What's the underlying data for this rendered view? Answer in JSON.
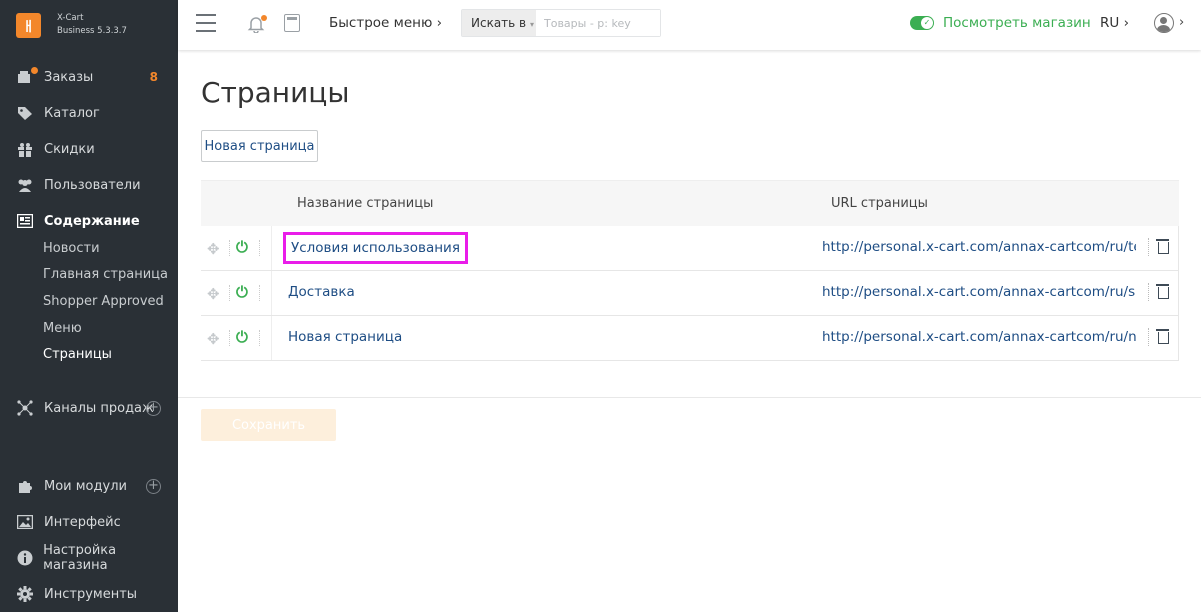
{
  "brand": {
    "name": "X-Cart",
    "edition": "Business 5.3.3.7",
    "logo_glyph": "ㅐ"
  },
  "sidebar": {
    "items": [
      {
        "label": "Заказы",
        "icon": "orders-icon",
        "badge": "8"
      },
      {
        "label": "Каталог",
        "icon": "tag-icon"
      },
      {
        "label": "Скидки",
        "icon": "gift-icon"
      },
      {
        "label": "Пользователи",
        "icon": "users-icon"
      },
      {
        "label": "Содержание",
        "icon": "content-icon"
      },
      {
        "label": "Каналы продаж",
        "icon": "channels-icon"
      },
      {
        "label": "Мои модули",
        "icon": "puzzle-icon"
      },
      {
        "label": "Интерфейс",
        "icon": "image-icon"
      },
      {
        "label": "Настройка магазина",
        "icon": "info-icon"
      },
      {
        "label": "Инструменты",
        "icon": "gear-icon"
      }
    ],
    "content_subitems": [
      "Новости",
      "Главная страница",
      "Shopper Approved",
      "Меню",
      "Страницы"
    ]
  },
  "header": {
    "quick_menu": "Быстрое меню",
    "search_select": "Искать в",
    "search_placeholder": "Товары - p: key",
    "view_store": "Посмотреть магазин",
    "language": "RU"
  },
  "main": {
    "title": "Страницы",
    "new_page_button": "Новая страница",
    "columns": {
      "name": "Название страницы",
      "url": "URL страницы"
    },
    "rows": [
      {
        "name": "Условия использования",
        "url": "http://personal.x-cart.com/annax-cartcom/ru/terms",
        "highlighted": true
      },
      {
        "name": "Доставка",
        "url": "http://personal.x-cart.com/annax-cartcom/ru/shipping"
      },
      {
        "name": "Новая страница",
        "url": "http://personal.x-cart.com/annax-cartcom/ru/novaya"
      }
    ],
    "save_button": "Сохранить"
  },
  "colors": {
    "accent": "#f3872b",
    "sidebar_bg": "#2a3036",
    "link": "#1e4d84",
    "green": "#3bae52",
    "highlight": "#e91de9"
  }
}
